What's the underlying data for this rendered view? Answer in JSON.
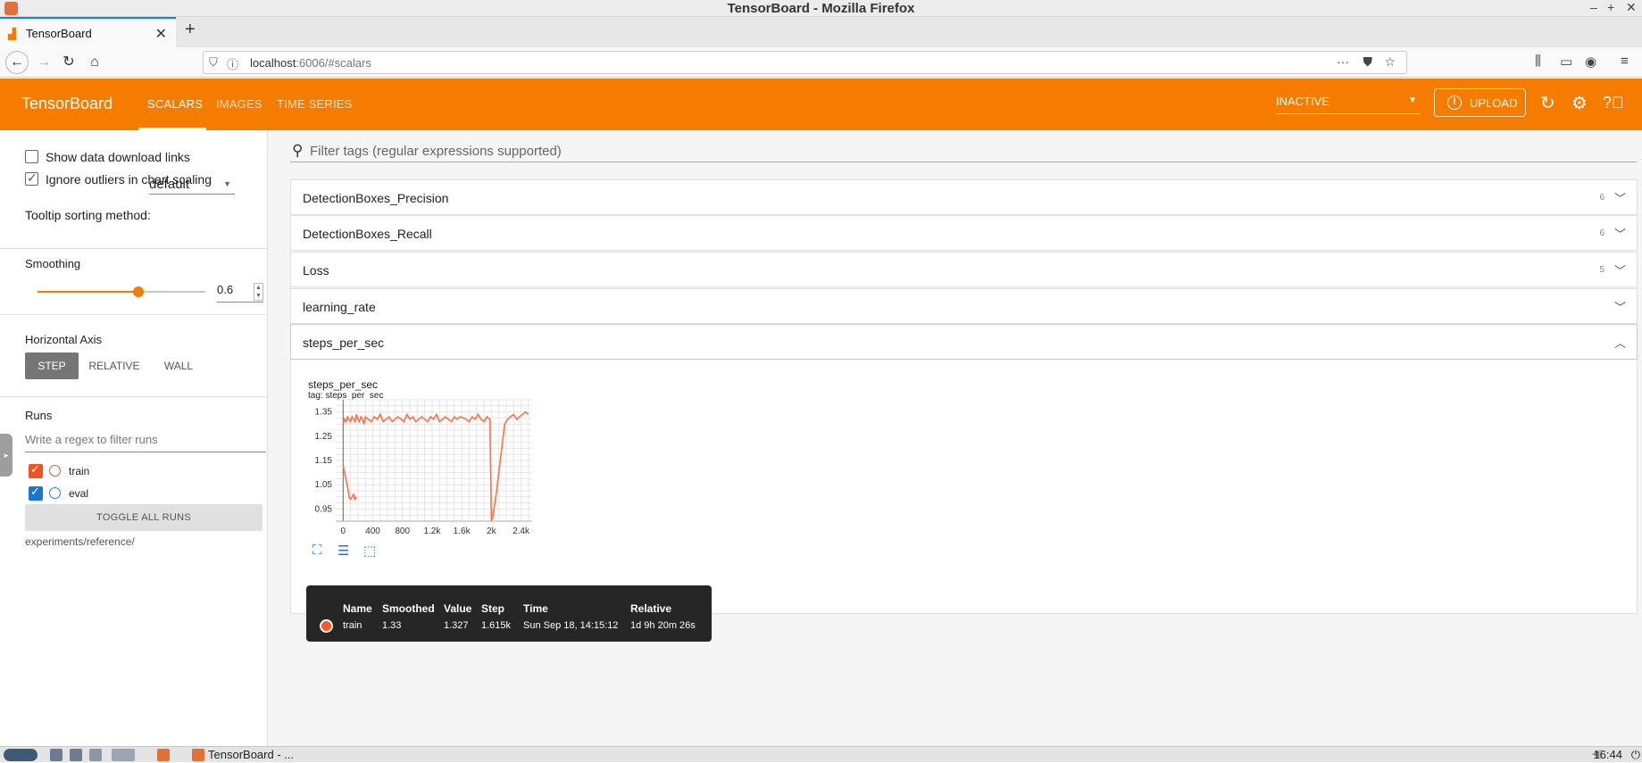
{
  "window": {
    "title": "TensorBoard - Mozilla Firefox"
  },
  "browser": {
    "tab_title": "TensorBoard",
    "url_host": "localhost",
    "url_rest": ":6006/#scalars"
  },
  "header": {
    "brand": "TensorBoard",
    "tabs": [
      "SCALARS",
      "IMAGES",
      "TIME SERIES"
    ],
    "active_tab": "SCALARS",
    "status": "INACTIVE",
    "upload_label": "UPLOAD",
    "accent_color": "#f57c00"
  },
  "sidebar": {
    "show_download": "Show data download links",
    "ignore_outliers": "Ignore outliers in chart scaling",
    "tooltip_label": "Tooltip sorting method:",
    "tooltip_value": "default",
    "smoothing_label": "Smoothing",
    "smoothing_value": "0.6",
    "smoothing_fraction": 0.6,
    "haxis_label": "Horizontal Axis",
    "haxis_options": [
      "STEP",
      "RELATIVE",
      "WALL"
    ],
    "haxis_active": "STEP",
    "runs_label": "Runs",
    "runs_filter_placeholder": "Write a regex to filter runs",
    "runs": [
      {
        "name": "train",
        "color": "#f4511e",
        "checked": true
      },
      {
        "name": "eval",
        "color": "#1e88e5",
        "checked": true
      }
    ],
    "toggle_all": "TOGGLE ALL RUNS",
    "logdir": "experiments/reference/"
  },
  "main": {
    "filter_placeholder": "Filter tags (regular expressions supported)",
    "groups": [
      {
        "name": "DetectionBoxes_Precision",
        "count": "6",
        "expanded": false
      },
      {
        "name": "DetectionBoxes_Recall",
        "count": "6",
        "expanded": false
      },
      {
        "name": "Loss",
        "count": "5",
        "expanded": false
      },
      {
        "name": "learning_rate",
        "count": "",
        "expanded": false
      },
      {
        "name": "steps_per_sec",
        "count": "",
        "expanded": true
      }
    ],
    "card": {
      "title": "steps_per_sec",
      "tag": "tag: steps_per_sec"
    }
  },
  "chart_data": {
    "type": "line",
    "title": "steps_per_sec",
    "xlabel": "",
    "ylabel": "",
    "x_ticks": [
      "0",
      "400",
      "800",
      "1.2k",
      "1.6k",
      "2k",
      "2.4k"
    ],
    "y_ticks": [
      "0.95",
      "1.05",
      "1.15",
      "1.25",
      "1.35"
    ],
    "xlim": [
      -100,
      2550
    ],
    "ylim": [
      0.9,
      1.4
    ],
    "grid": true,
    "series": [
      {
        "name": "train",
        "color": "#ff7043",
        "x": [
          0,
          20,
          40,
          60,
          80,
          100,
          120,
          140,
          160,
          180,
          200,
          220,
          240,
          260,
          280,
          300,
          340,
          380,
          420,
          460,
          500,
          540,
          580,
          620,
          660,
          700,
          740,
          780,
          820,
          860,
          900,
          940,
          980,
          1020,
          1060,
          1100,
          1140,
          1180,
          1220,
          1260,
          1300,
          1340,
          1380,
          1420,
          1460,
          1500,
          1540,
          1580,
          1615,
          1660,
          1700,
          1740,
          1780,
          1820,
          1860,
          1900,
          1940,
          1980,
          2000,
          2020,
          2060,
          2100,
          2140,
          2180,
          2220,
          2260,
          2300,
          2340,
          2380,
          2420,
          2460,
          2500
        ],
        "y": [
          1.3,
          1.32,
          1.31,
          1.33,
          1.32,
          1.31,
          1.33,
          1.32,
          1.31,
          1.34,
          1.32,
          1.31,
          1.33,
          1.32,
          1.3,
          1.33,
          1.32,
          1.31,
          1.33,
          1.32,
          1.34,
          1.31,
          1.32,
          1.33,
          1.31,
          1.32,
          1.33,
          1.32,
          1.31,
          1.34,
          1.32,
          1.33,
          1.31,
          1.32,
          1.33,
          1.32,
          1.31,
          1.33,
          1.32,
          1.34,
          1.31,
          1.32,
          1.33,
          1.32,
          1.31,
          1.33,
          1.32,
          1.33,
          1.327,
          1.32,
          1.31,
          1.33,
          1.32,
          1.34,
          1.32,
          1.31,
          1.33,
          1.32,
          0.9,
          0.92,
          1.0,
          1.1,
          1.2,
          1.3,
          1.32,
          1.33,
          1.34,
          1.32,
          1.33,
          1.34,
          1.35,
          1.34
        ]
      },
      {
        "name": "train",
        "color": "#ff7043",
        "x": [
          0,
          20,
          40,
          60,
          80,
          100,
          120,
          140,
          160,
          180
        ],
        "y": [
          1.13,
          1.1,
          1.07,
          1.04,
          1.0,
          0.99,
          1.0,
          1.01,
          0.99,
          1.0
        ]
      }
    ]
  },
  "tooltip": {
    "headers": [
      "Name",
      "Smoothed",
      "Value",
      "Step",
      "Time",
      "Relative"
    ],
    "row": [
      "train",
      "1.33",
      "1.327",
      "1.615k",
      "Sun Sep 18, 14:15:12",
      "1d 9h 20m 26s"
    ]
  },
  "taskbar": {
    "task": "TensorBoard - ...",
    "clock": "16:44"
  }
}
